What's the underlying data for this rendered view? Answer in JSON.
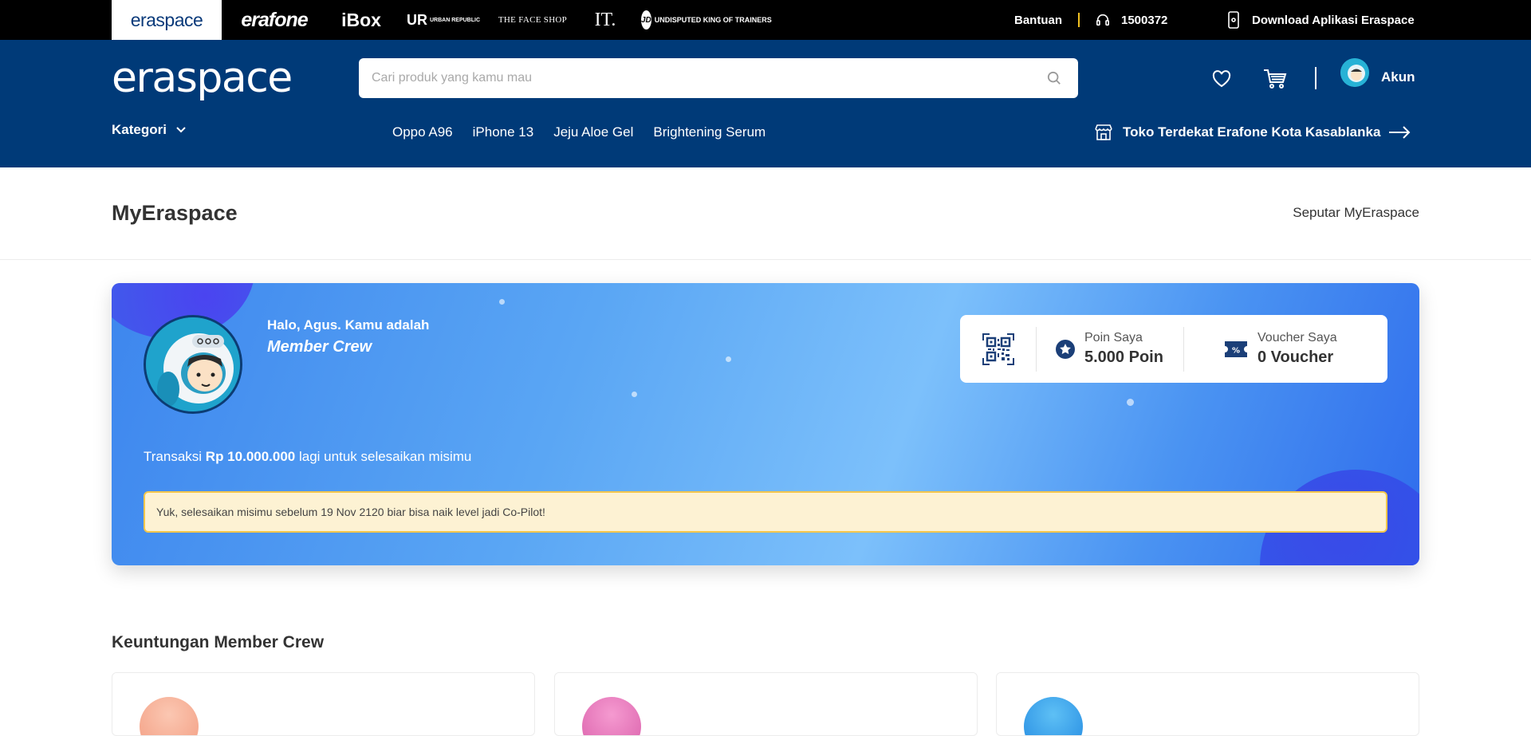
{
  "brands": {
    "items": [
      {
        "label": "eraspace",
        "active": true
      },
      {
        "label": "erafone"
      },
      {
        "label": "iBox"
      },
      {
        "label": "UR",
        "sub": "URBAN REPUBLIC"
      },
      {
        "label": "THE FACE SHOP"
      },
      {
        "label": "IT."
      },
      {
        "label": "JD",
        "sub": "UNDISPUTED KING OF TRAINERS"
      }
    ]
  },
  "topbar": {
    "help_label": "Bantuan",
    "phone": "1500372",
    "download_label": "Download Aplikasi Eraspace",
    "icons": {
      "phone": "headset-icon",
      "download": "smartphone-icon"
    }
  },
  "header": {
    "logo": "eraspace",
    "search_placeholder": "Cari produk yang kamu mau",
    "account_label": "Akun",
    "category_label": "Kategori",
    "quick_links": [
      "Oppo A96",
      "iPhone 13",
      "Jeju Aloe Gel",
      "Brightening Serum"
    ],
    "store_label": "Toko Terdekat Erafone Kota Kasablanka",
    "icons": {
      "search": "search-icon",
      "wishlist": "heart-icon",
      "cart": "cart-icon",
      "store": "store-icon"
    }
  },
  "page": {
    "title": "MyEraspace",
    "about_link": "Seputar MyEraspace"
  },
  "member_card": {
    "greeting": "Halo, Agus. Kamu adalah",
    "level": "Member Crew",
    "points_label": "Poin Saya",
    "points_value": "5.000 Poin",
    "voucher_label": "Voucher Saya",
    "voucher_value": "0 Voucher",
    "mission_prefix": "Transaksi",
    "mission_amount": "Rp 10.000.000",
    "mission_suffix": "lagi untuk selesaikan misimu",
    "notice": "Yuk, selesaikan misimu sebelum 19 Nov 2120 biar bisa naik level jadi Co-Pilot!",
    "colors": {
      "gradient_start": "#3d86ee",
      "gradient_mid": "#7cc0fb",
      "gradient_end": "#2f6cec",
      "notice_bg": "#fdf2d3",
      "notice_border": "#f4c64c"
    }
  },
  "benefits": {
    "title": "Keuntungan Member Crew",
    "icon_colors": [
      "#f6a98e",
      "#e56bb6",
      "#2d9ae8"
    ]
  },
  "colors": {
    "header_bg": "#003a78",
    "topbar_bg": "#000000",
    "accent_yellow": "#f0c020"
  }
}
